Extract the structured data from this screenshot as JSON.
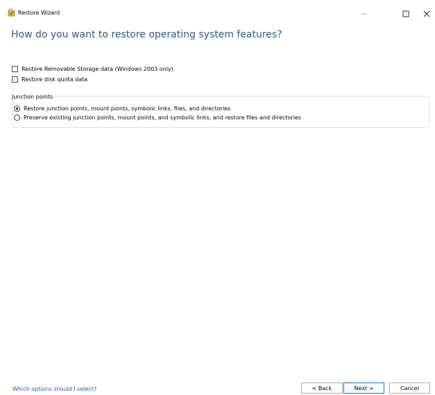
{
  "window": {
    "title": "Restore Wizard"
  },
  "page": {
    "heading": "How do you want to restore operating system features?"
  },
  "options": {
    "removable_storage": {
      "label": "Restore Removable Storage data (Windows 2003 only)",
      "checked": false
    },
    "disk_quota": {
      "label": "Restore disk quota data",
      "checked": false
    }
  },
  "junction_points": {
    "group_label": "Junction points",
    "choices": [
      {
        "label": "Restore junction points, mount points, symbolic links, files, and directories",
        "selected": true
      },
      {
        "label": "Preserve existing junction points, mount points, and symbolic links, and restore files and directories",
        "selected": false
      }
    ]
  },
  "footer": {
    "help_link": "Which options should I select?",
    "back_label": "< Back",
    "next_label": "Next >",
    "cancel_label": "Cancel"
  },
  "icons": {
    "app": "restore-wizard-icon",
    "minimize": "minimize-icon",
    "maximize": "maximize-icon",
    "close": "close-icon"
  },
  "colors": {
    "heading": "#2d5a8a",
    "link": "#1a5fa8",
    "default_button_border": "#0078d7"
  }
}
